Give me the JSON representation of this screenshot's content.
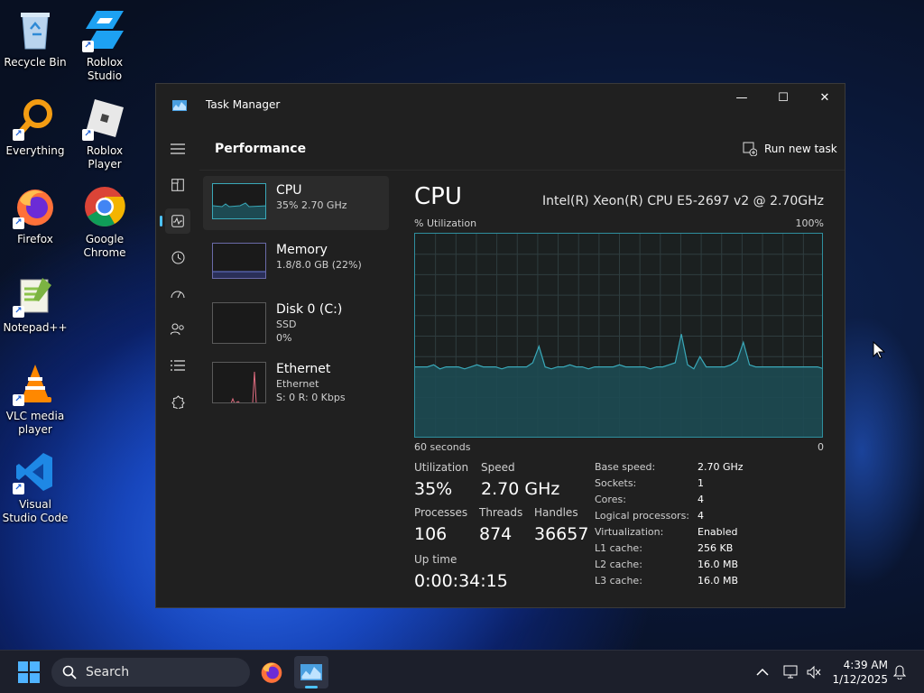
{
  "desktop": {
    "icons": [
      {
        "label": "Recycle Bin",
        "icon": "recycle-bin-icon"
      },
      {
        "label": "Roblox Studio",
        "icon": "roblox-studio-icon"
      },
      {
        "label": "Everything",
        "icon": "everything-search-icon"
      },
      {
        "label": "Roblox Player",
        "icon": "roblox-player-icon"
      },
      {
        "label": "Firefox",
        "icon": "firefox-icon"
      },
      {
        "label": "Google Chrome",
        "icon": "chrome-icon"
      },
      {
        "label": "Notepad++",
        "icon": "notepad-plus-plus-icon"
      },
      {
        "label": "VLC media player",
        "icon": "vlc-icon"
      },
      {
        "label": "Visual Studio Code",
        "icon": "vscode-icon"
      }
    ]
  },
  "window": {
    "title": "Task Manager",
    "controls": {
      "minimize": "—",
      "maximize": "☐",
      "close": "✕"
    }
  },
  "header": {
    "title": "Performance",
    "run_new_task": "Run new task",
    "more": "•••"
  },
  "resources": [
    {
      "name": "CPU",
      "sub1": "35%  2.70 GHz",
      "sub2": ""
    },
    {
      "name": "Memory",
      "sub1": "1.8/8.0 GB (22%)",
      "sub2": ""
    },
    {
      "name": "Disk 0 (C:)",
      "sub1": "SSD",
      "sub2": "0%"
    },
    {
      "name": "Ethernet",
      "sub1": "Ethernet",
      "sub2": "S: 0 R: 0 Kbps"
    }
  ],
  "detail": {
    "title": "CPU",
    "cpu_name": "Intel(R) Xeon(R) CPU E5-2697 v2 @ 2.70GHz",
    "graph_label": "% Utilization",
    "graph_max": "100%",
    "graph_time": "60 seconds",
    "graph_min": "0",
    "utilization_label": "Utilization",
    "utilization": "35%",
    "speed_label": "Speed",
    "speed": "2.70 GHz",
    "processes_label": "Processes",
    "processes": "106",
    "threads_label": "Threads",
    "threads": "874",
    "handles_label": "Handles",
    "handles": "36657",
    "uptime_label": "Up time",
    "uptime": "0:00:34:15",
    "specs": [
      {
        "k": "Base speed:",
        "v": "2.70 GHz"
      },
      {
        "k": "Sockets:",
        "v": "1"
      },
      {
        "k": "Cores:",
        "v": "4"
      },
      {
        "k": "Logical processors:",
        "v": "4"
      },
      {
        "k": "Virtualization:",
        "v": "Enabled"
      },
      {
        "k": "L1 cache:",
        "v": "256 KB"
      },
      {
        "k": "L2 cache:",
        "v": "16.0 MB"
      },
      {
        "k": "L3 cache:",
        "v": "16.0 MB"
      }
    ],
    "cpu_history": [
      35,
      35,
      35,
      36,
      34,
      35,
      35,
      35,
      34,
      35,
      36,
      35,
      35,
      35,
      34,
      35,
      35,
      35,
      35,
      37,
      45,
      35,
      34,
      35,
      35,
      36,
      35,
      35,
      34,
      35,
      35,
      35,
      35,
      36,
      35,
      35,
      35,
      35,
      34,
      35,
      35,
      36,
      37,
      51,
      36,
      34,
      40,
      35,
      35,
      35,
      35,
      36,
      38,
      47,
      36,
      35,
      35,
      35,
      35,
      35,
      35,
      35,
      35,
      35,
      35,
      35,
      34
    ]
  },
  "taskbar": {
    "search_placeholder": "Search",
    "time": "4:39 AM",
    "date": "1/12/2025"
  },
  "colors": {
    "accent": "#4cc2ff",
    "graph_line": "#3aa8b8",
    "graph_fill": "#1d4a52",
    "net_spike": "#e06c80"
  }
}
